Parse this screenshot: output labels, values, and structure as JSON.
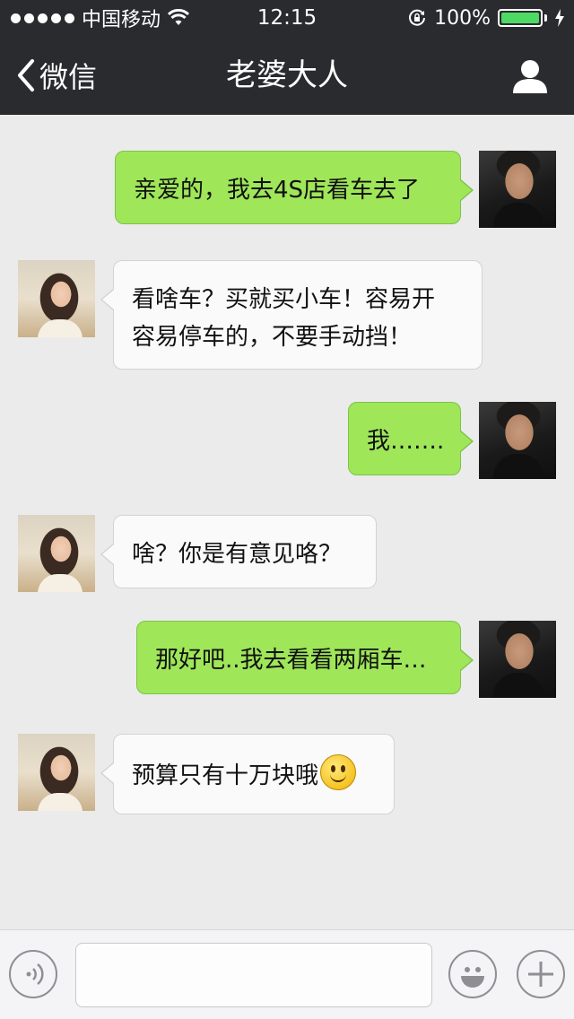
{
  "status_bar": {
    "carrier": "中国移动",
    "time": "12:15",
    "battery": "100%",
    "battery_level": 1.0,
    "signal_dots": 5
  },
  "nav": {
    "back_label": "微信",
    "title": "老婆大人"
  },
  "messages": [
    {
      "side": "out",
      "lines": [
        "亲爱的，我去4S店看车去了"
      ]
    },
    {
      "side": "in",
      "lines": [
        "看啥车？买就买小车！容易开",
        "容易停车的，不要手动挡！"
      ]
    },
    {
      "side": "out",
      "lines": [
        "我……."
      ]
    },
    {
      "side": "in",
      "lines": [
        "啥？你是有意见咯？"
      ]
    },
    {
      "side": "out",
      "lines": [
        "那好吧..我去看看两厢车…"
      ]
    },
    {
      "side": "in",
      "lines": [
        "预算只有十万块哦"
      ],
      "emoji": "smiley-face"
    }
  ],
  "colors": {
    "bar_bg": "#2a2b2f",
    "chat_bg": "#ebebeb",
    "outgoing_bubble": "#9fe659",
    "incoming_bubble": "#fafafa",
    "battery": "#4cd964"
  },
  "input": {
    "placeholder": ""
  }
}
